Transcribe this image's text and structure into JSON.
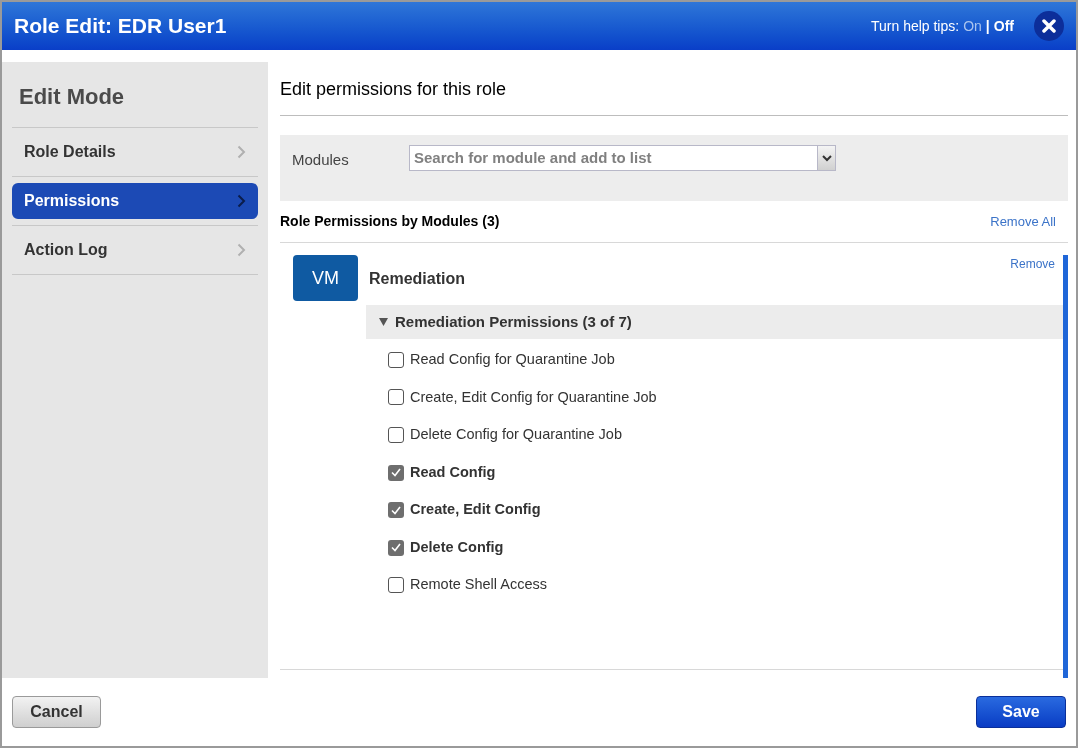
{
  "window": {
    "title": "Role Edit: EDR User1"
  },
  "help_tips": {
    "label": "Turn help tips:",
    "separator": "|",
    "options": [
      {
        "label": "On",
        "selected": false
      },
      {
        "label": "Off",
        "selected": true
      }
    ]
  },
  "sidebar": {
    "title": "Edit Mode",
    "items": [
      {
        "label": "Role Details",
        "selected": false
      },
      {
        "label": "Permissions",
        "selected": true
      },
      {
        "label": "Action Log",
        "selected": false
      }
    ]
  },
  "main": {
    "heading": "Edit permissions for this role",
    "modules_field": {
      "label": "Modules",
      "placeholder": "Search for module and add to list"
    },
    "section_title": "Role Permissions by Modules (3)",
    "remove_all": "Remove All",
    "modules": [
      {
        "badge": "VM",
        "name": "Remediation",
        "remove": "Remove",
        "group": {
          "title": "Remediation Permissions (3 of 7)",
          "expanded": true,
          "permissions": [
            {
              "label": "Read Config for Quarantine Job",
              "checked": false
            },
            {
              "label": "Create, Edit Config for Quarantine Job",
              "checked": false
            },
            {
              "label": "Delete Config for Quarantine Job",
              "checked": false
            },
            {
              "label": "Read Config",
              "checked": true
            },
            {
              "label": "Create, Edit Config",
              "checked": true
            },
            {
              "label": "Delete Config",
              "checked": true
            },
            {
              "label": "Remote Shell Access",
              "checked": false
            }
          ]
        }
      }
    ]
  },
  "footer": {
    "buttons": [
      {
        "label": "Cancel",
        "kind": "secondary"
      },
      {
        "label": "Save",
        "kind": "primary"
      }
    ]
  }
}
